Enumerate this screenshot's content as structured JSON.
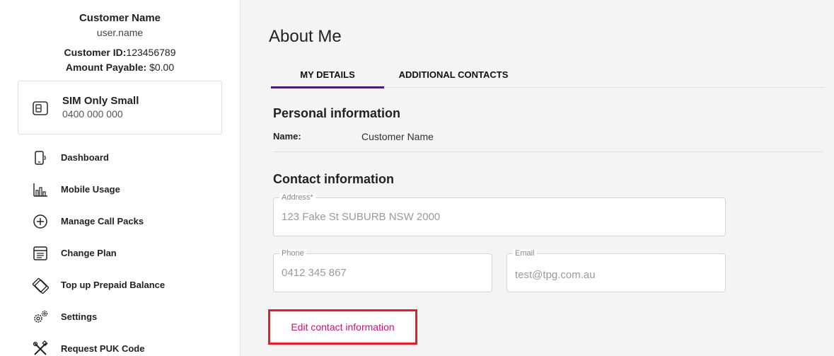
{
  "profile": {
    "customer_name": "Customer Name",
    "username": "user.name",
    "customer_id_label": "Customer ID:",
    "customer_id": "123456789",
    "amount_label": "Amount Payable:",
    "amount": "$0.00"
  },
  "plan": {
    "name": "SIM Only Small",
    "number": "0400 000 000",
    "icon": "sim-card-icon"
  },
  "nav": {
    "items": [
      {
        "label": "Dashboard",
        "icon": "phone-icon"
      },
      {
        "label": "Mobile Usage",
        "icon": "bar-chart-icon"
      },
      {
        "label": "Manage Call Packs",
        "icon": "plus-circle-icon"
      },
      {
        "label": "Change Plan",
        "icon": "plan-list-icon"
      },
      {
        "label": "Top up Prepaid Balance",
        "icon": "top-up-card-icon"
      },
      {
        "label": "Settings",
        "icon": "gears-icon"
      },
      {
        "label": "Request PUK Code",
        "icon": "tools-icon"
      }
    ]
  },
  "main": {
    "title": "About Me",
    "tabs": [
      {
        "label": "MY DETAILS",
        "active": true
      },
      {
        "label": "ADDITIONAL CONTACTS",
        "active": false
      }
    ],
    "personal": {
      "title": "Personal information",
      "name_label": "Name:",
      "name_value": "Customer Name"
    },
    "contact": {
      "title": "Contact information",
      "address_label": "Address*",
      "address_value": "123 Fake St SUBURB NSW 2000",
      "phone_label": "Phone",
      "phone_value": "0412 345 867",
      "email_label": "Email",
      "email_value": "test@tpg.com.au"
    },
    "edit_button": "Edit contact information"
  },
  "colors": {
    "accent_purple": "#4a1d6e",
    "button_text": "#c7157e",
    "highlight_box": "#e21f26"
  }
}
